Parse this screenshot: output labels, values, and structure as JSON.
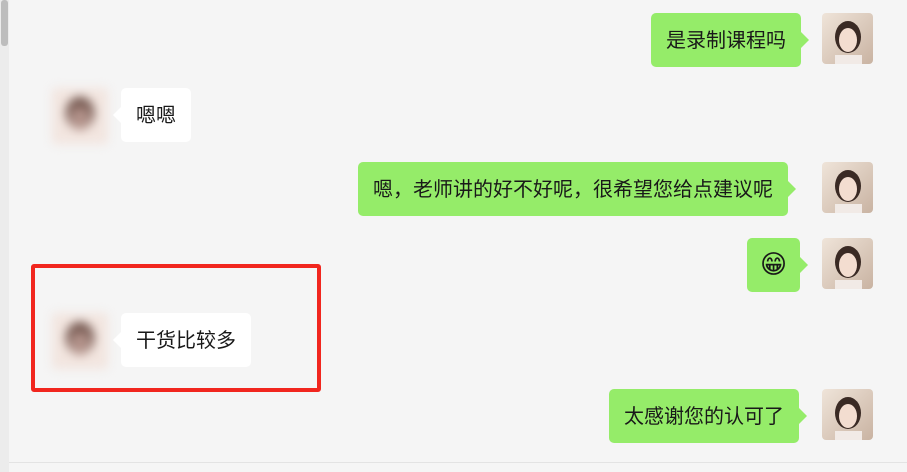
{
  "messages": [
    {
      "sender": "me",
      "text": "是录制课程吗"
    },
    {
      "sender": "other",
      "text": "嗯嗯"
    },
    {
      "sender": "me",
      "text": "嗯，老师讲的好不好呢，很希望您给点建议呢"
    },
    {
      "sender": "me",
      "text": "😁",
      "icon": "grinning-face-emoji"
    },
    {
      "sender": "other",
      "text": "干货比较多"
    },
    {
      "sender": "me",
      "text": "太感谢您的认可了"
    }
  ],
  "colors": {
    "background": "#f5f5f5",
    "my_bubble": "#95ec69",
    "other_bubble": "#ffffff",
    "highlight_box": "#f1261e"
  }
}
